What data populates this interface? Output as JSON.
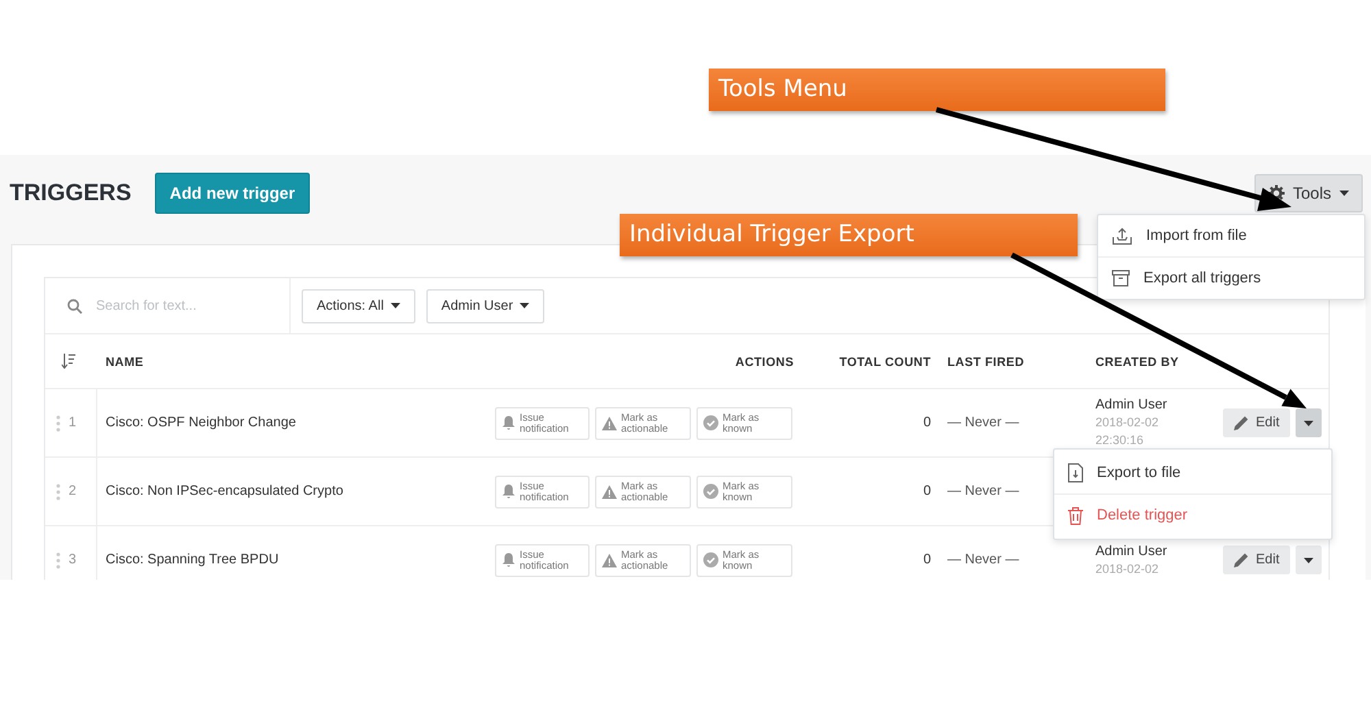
{
  "callouts": [
    {
      "text": "Tools Menu"
    },
    {
      "text": "Individual Trigger Export"
    }
  ],
  "header": {
    "title": "TRIGGERS",
    "add_button": "Add new trigger",
    "tools_button": "Tools"
  },
  "tools_menu": {
    "items": [
      {
        "label": "Import from file",
        "kind": "import"
      },
      {
        "label": "Export all triggers",
        "kind": "archive"
      }
    ]
  },
  "filters": {
    "search_placeholder": "Search for text...",
    "actions": "Actions: All",
    "user": "Admin User"
  },
  "columns": [
    "NAME",
    "ACTIONS",
    "TOTAL COUNT",
    "LAST FIRED",
    "CREATED BY"
  ],
  "rows": [
    {
      "index": "1",
      "name": "Cisco: OSPF Neighbor Change",
      "actions": [
        {
          "kind": "notify",
          "label": "Issue notification"
        },
        {
          "kind": "actionable",
          "label": "Mark as actionable"
        },
        {
          "kind": "known",
          "label": "Mark as known"
        }
      ],
      "total_count": "0",
      "last_fired": "— Never —",
      "created_by": "Admin User",
      "created_date": "2018-02-02",
      "created_time": "22:30:16",
      "edit": "Edit",
      "menu_open": true
    },
    {
      "index": "2",
      "name": "Cisco: Non IPSec-encapsulated Crypto",
      "actions": [
        {
          "kind": "notify",
          "label": "Issue notification"
        },
        {
          "kind": "actionable",
          "label": "Mark as actionable"
        },
        {
          "kind": "known",
          "label": "Mark as known"
        }
      ],
      "total_count": "0",
      "last_fired": "— Never —"
    },
    {
      "index": "3",
      "name": "Cisco: Spanning Tree BPDU",
      "actions": [
        {
          "kind": "notify",
          "label": "Issue notification"
        },
        {
          "kind": "actionable",
          "label": "Mark as actionable"
        },
        {
          "kind": "known",
          "label": "Mark as known"
        }
      ],
      "total_count": "0",
      "last_fired": "— Never —",
      "created_by": "Admin User",
      "created_date": "2018-02-02",
      "edit": "Edit",
      "menu_open": false
    }
  ],
  "row_menu": {
    "items": [
      {
        "label": "Export to file",
        "kind": "normal"
      },
      {
        "label": "Delete trigger",
        "kind": "danger"
      }
    ]
  }
}
